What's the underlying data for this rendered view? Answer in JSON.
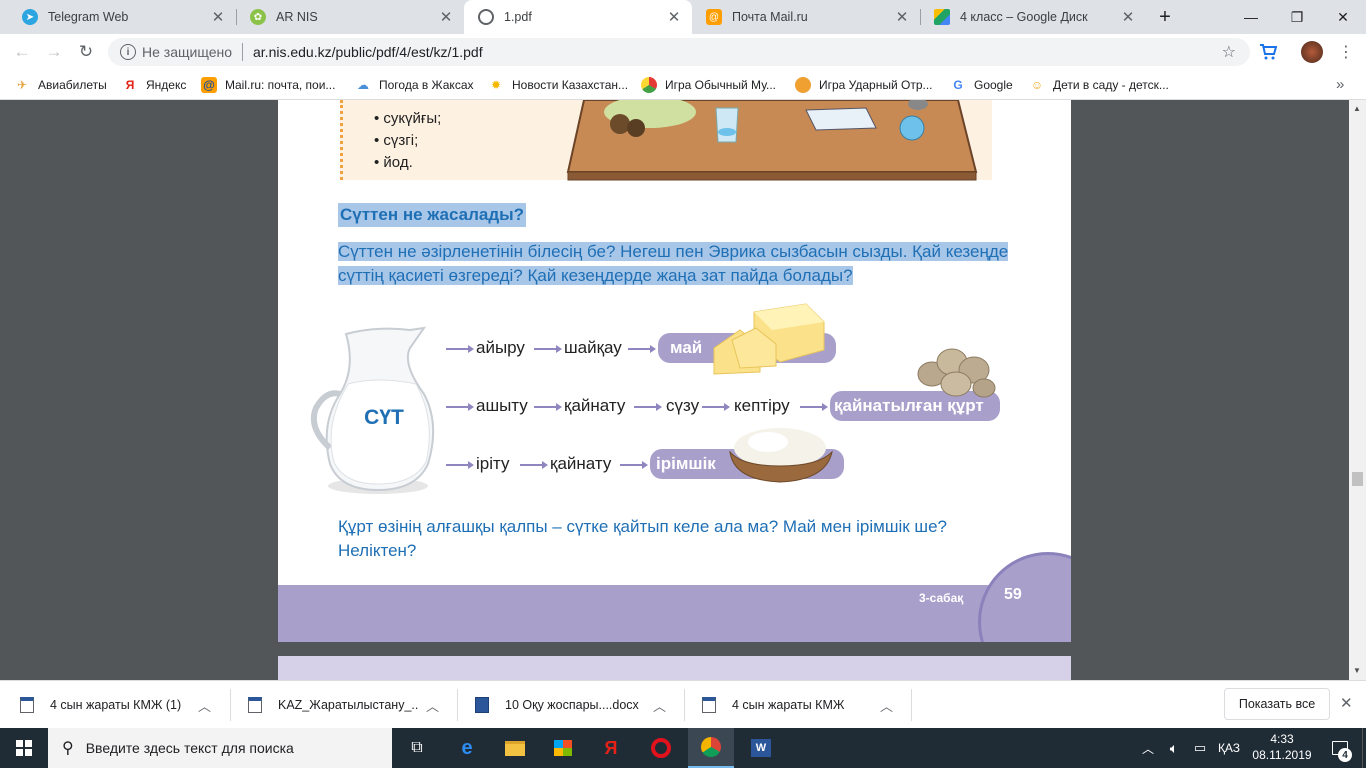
{
  "tabs": [
    {
      "title": "Telegram Web",
      "icon": "telegram-icon",
      "color": "#2ca5e0"
    },
    {
      "title": "AR NIS",
      "icon": "nis-logo-icon",
      "color": "#8bc34a"
    },
    {
      "title": "1.pdf",
      "icon": "globe-icon",
      "color": "#5f6368"
    },
    {
      "title": "Почта Mail.ru",
      "icon": "mailru-icon",
      "color": "#168de2"
    },
    {
      "title": "4 класс – Google Диск",
      "icon": "google-drive-icon",
      "color": "#1fa463"
    }
  ],
  "toolbar": {
    "security_label": "Не защищено",
    "url": "ar.nis.edu.kz/public/pdf/4/est/kz/1.pdf"
  },
  "bookmarks": [
    {
      "label": "Авиабилеты",
      "icon": "plane-icon"
    },
    {
      "label": "Яндекс",
      "icon": "yandex-icon"
    },
    {
      "label": "Mail.ru: почта, пои...",
      "icon": "mailru-icon"
    },
    {
      "label": "Погода в Жаксах",
      "icon": "weather-icon"
    },
    {
      "label": "Новости Казахстан...",
      "icon": "news-icon"
    },
    {
      "label": "Игра Обычный Му...",
      "icon": "game-icon"
    },
    {
      "label": "Игра Ударный Отр...",
      "icon": "game-owl-icon"
    },
    {
      "label": "Google",
      "icon": "google-icon"
    },
    {
      "label": "Дети в саду - детск...",
      "icon": "kids-icon"
    }
  ],
  "pdf": {
    "list_items": [
      "сукүйғы;",
      "сүзгі;",
      "йод."
    ],
    "heading": "Сүттен не жасалады?",
    "intro_line1": "Сүттен не әзірленетінін білесің бе? Негеш пен Эврика сызбасын сызды. Қай кезеңде",
    "intro_line2": "сүттің қасиеті өзгереді? Қай кезеңдерде жаңа зат пайда болады?",
    "milk_label": "СҮТ",
    "row1": {
      "steps": [
        "айыру",
        "шайқау"
      ],
      "result": "май"
    },
    "row2": {
      "steps": [
        "ашыту",
        "қайнату",
        "сүзу",
        "кептіру"
      ],
      "result": "қайнатылған құрт"
    },
    "row3": {
      "steps": [
        "іріту",
        "қайнату"
      ],
      "result": "ірімшік"
    },
    "question_line1": "Құрт өзінің алғашқы қалпы – сүтке қайтып келе ала ма? Май мен ірімшік ше?",
    "question_line2": "Неліктен?",
    "footer_lesson": "3-сабақ",
    "footer_page": "59",
    "accent_color": "#1f6fb5",
    "band_color": "#a89fcb"
  },
  "downloads": {
    "items": [
      "4 сын жараты КМЖ (1)",
      "KAZ_Жаратылыстану_...",
      "10 Оқу жоспары....docx",
      "4 сын жараты КМЖ"
    ],
    "show_all": "Показать все"
  },
  "taskbar": {
    "search_placeholder": "Введите здесь текст для поиска",
    "lang": "ҚАЗ",
    "time": "4:33",
    "date": "08.11.2019",
    "notif_count": "4"
  }
}
